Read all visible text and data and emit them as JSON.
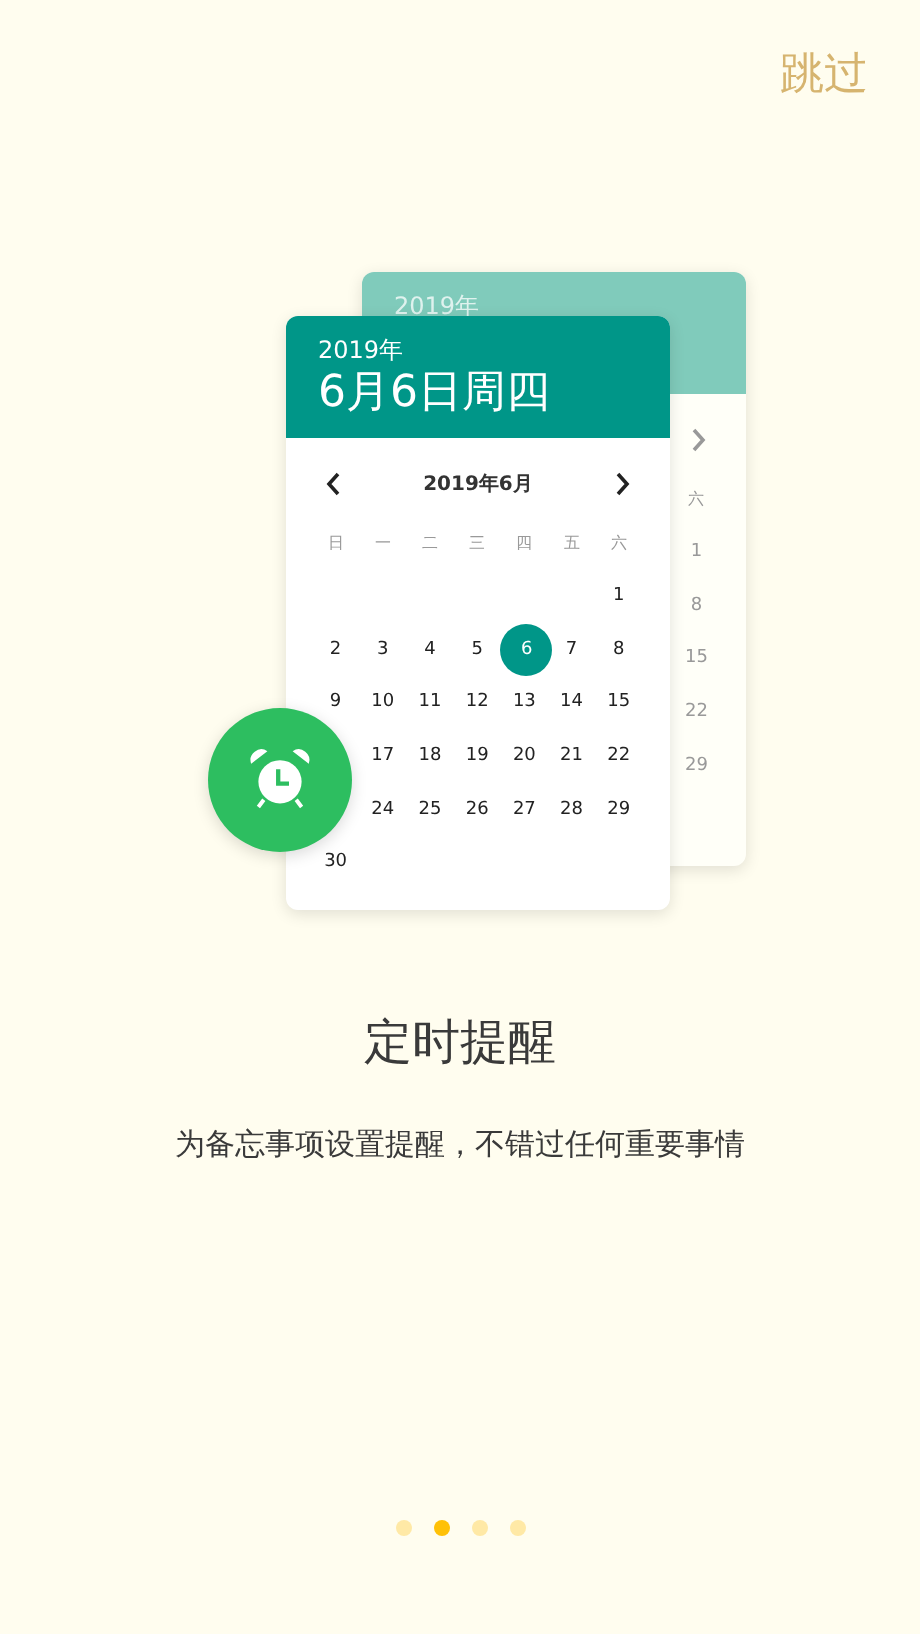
{
  "skip_button": "跳过",
  "back_card": {
    "year": "2019年",
    "weekday": "六",
    "days": [
      "1",
      "8",
      "15",
      "22",
      "29"
    ]
  },
  "front_card": {
    "year": "2019年",
    "date": "6月6日周四",
    "month": "2019年6月",
    "weekdays": [
      "日",
      "一",
      "二",
      "三",
      "四",
      "五",
      "六"
    ],
    "weeks": [
      {
        "days": [
          {
            "day": "1",
            "selected": false
          }
        ]
      },
      {
        "days": [
          {
            "day": "2",
            "selected": false
          },
          {
            "day": "3",
            "selected": false
          },
          {
            "day": "4",
            "selected": false
          },
          {
            "day": "5",
            "selected": false
          },
          {
            "day": "6",
            "selected": true
          },
          {
            "day": "7",
            "selected": false
          },
          {
            "day": "8",
            "selected": false
          }
        ]
      },
      {
        "days": [
          {
            "day": "9",
            "selected": false
          },
          {
            "day": "10",
            "selected": false
          },
          {
            "day": "11",
            "selected": false
          },
          {
            "day": "12",
            "selected": false
          },
          {
            "day": "13",
            "selected": false
          },
          {
            "day": "14",
            "selected": false
          },
          {
            "day": "15",
            "selected": false
          }
        ]
      },
      {
        "days": [
          {
            "day": "17",
            "selected": false
          },
          {
            "day": "18",
            "selected": false
          },
          {
            "day": "19",
            "selected": false
          },
          {
            "day": "20",
            "selected": false
          },
          {
            "day": "21",
            "selected": false
          },
          {
            "day": "22",
            "selected": false
          }
        ]
      },
      {
        "days": [
          {
            "day": "24",
            "selected": false
          },
          {
            "day": "25",
            "selected": false
          },
          {
            "day": "26",
            "selected": false
          },
          {
            "day": "27",
            "selected": false
          },
          {
            "day": "28",
            "selected": false
          },
          {
            "day": "29",
            "selected": false
          }
        ]
      },
      {
        "days": [
          {
            "day": "30",
            "selected": false
          }
        ]
      }
    ]
  },
  "title": "定时提醒",
  "subtitle": "为备忘事项设置提醒，不错过任何重要事情",
  "pages": [
    {
      "selected": false
    },
    {
      "selected": true
    },
    {
      "selected": false
    },
    {
      "selected": false
    }
  ]
}
